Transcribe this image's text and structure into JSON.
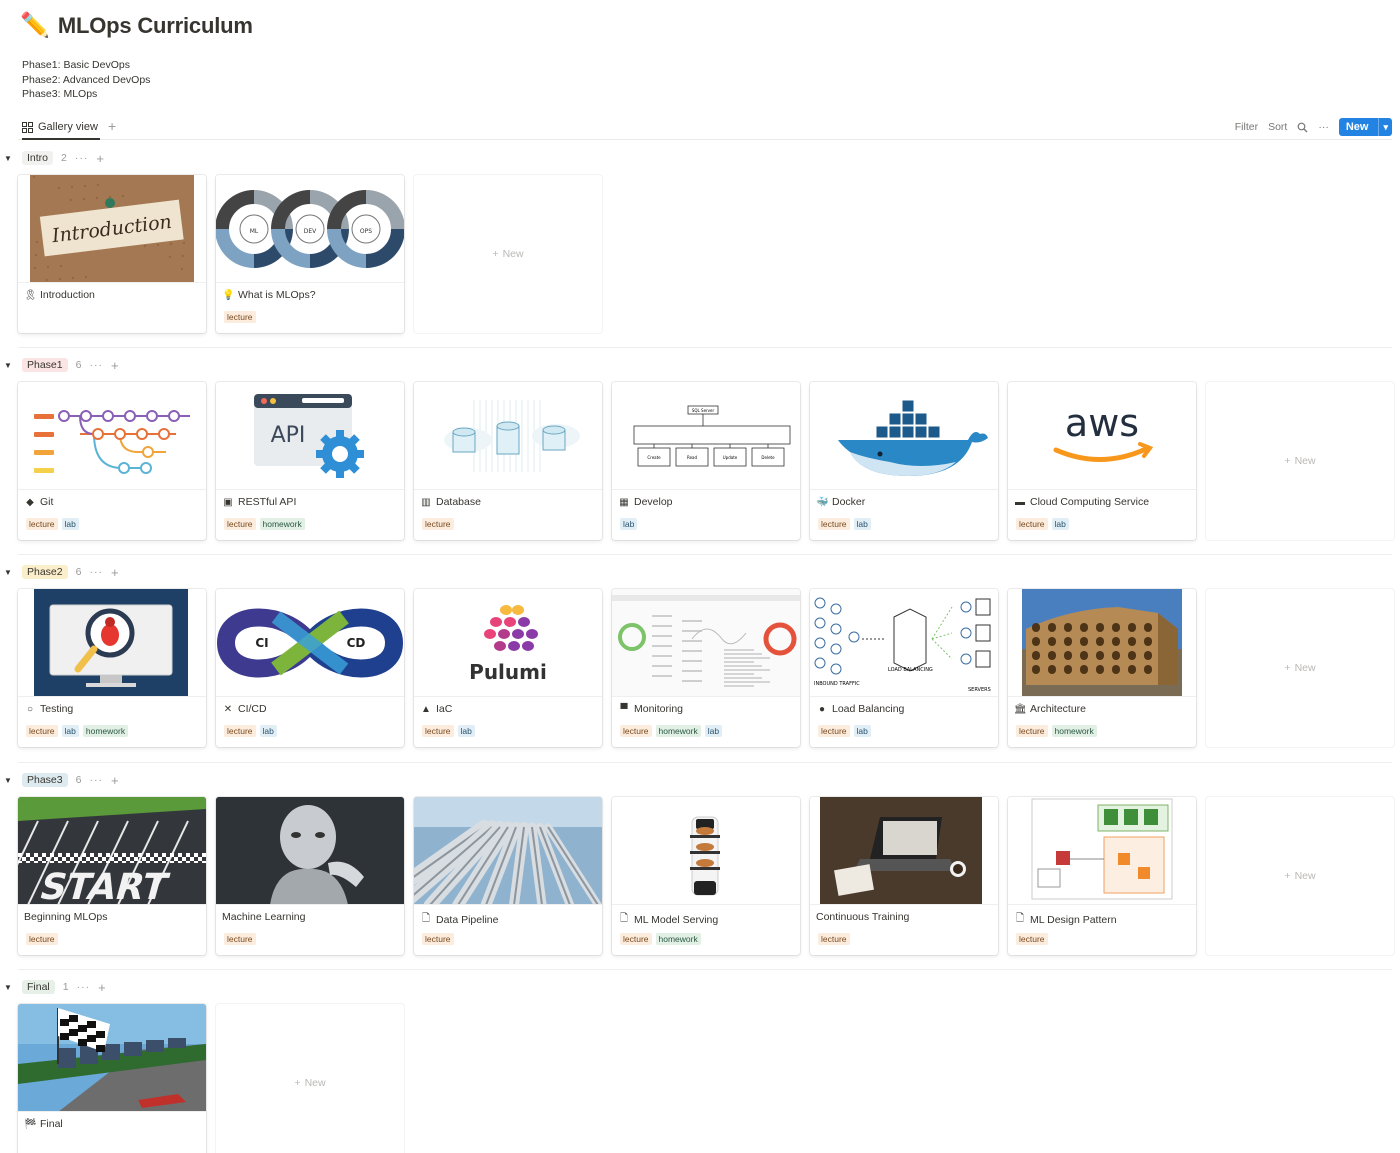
{
  "page": {
    "title": "MLOps Curriculum",
    "title_icon": "pencil-emoji",
    "description": [
      "Phase1: Basic DevOps",
      "Phase2: Advanced DevOps",
      "Phase3: MLOps"
    ]
  },
  "viewbar": {
    "view_label": "Gallery view",
    "add_view": "+",
    "filter": "Filter",
    "sort": "Sort",
    "more": "···",
    "new_label": "New",
    "new_caret": "⌄"
  },
  "tag_colors": {
    "lecture": "#fbecdd",
    "lab": "#e2eef6",
    "homework": "#e1efe5"
  },
  "accent": "#2383e2",
  "new_card_label": "New",
  "groups": [
    {
      "name": "Intro",
      "count": "2",
      "color": "#f1f1ef",
      "cards": [
        {
          "title": "Introduction",
          "icon": "ribbon-icon",
          "glyph": "🎗",
          "tags": []
        },
        {
          "title": "What is MLOps?",
          "icon": "lightbulb-icon",
          "glyph": "💡",
          "tags": [
            "lecture"
          ]
        }
      ]
    },
    {
      "name": "Phase1",
      "count": "6",
      "color": "#fbe4e4",
      "cards": [
        {
          "title": "Git",
          "icon": "git-icon",
          "glyph": "◆",
          "tags": [
            "lecture",
            "lab"
          ]
        },
        {
          "title": "RESTful API",
          "icon": "api-icon",
          "glyph": "▣",
          "tags": [
            "lecture",
            "homework"
          ]
        },
        {
          "title": "Database",
          "icon": "database-icon",
          "glyph": "▥",
          "tags": [
            "lecture"
          ]
        },
        {
          "title": "Develop",
          "icon": "develop-icon",
          "glyph": "▦",
          "tags": [
            "lab"
          ]
        },
        {
          "title": "Docker",
          "icon": "docker-icon",
          "glyph": "🐳",
          "tags": [
            "lecture",
            "lab"
          ]
        },
        {
          "title": "Cloud Computing Service",
          "icon": "aws-icon",
          "glyph": "▬",
          "tags": [
            "lecture",
            "lab"
          ]
        }
      ]
    },
    {
      "name": "Phase2",
      "count": "6",
      "color": "#fbeecb",
      "cards": [
        {
          "title": "Testing",
          "icon": "testing-icon",
          "glyph": "○",
          "tags": [
            "lecture",
            "lab",
            "homework"
          ]
        },
        {
          "title": "CI/CD",
          "icon": "cicd-icon",
          "glyph": "✕",
          "tags": [
            "lecture",
            "lab"
          ]
        },
        {
          "title": "IaC",
          "icon": "iac-icon",
          "glyph": "▲",
          "tags": [
            "lecture",
            "lab"
          ]
        },
        {
          "title": "Monitoring",
          "icon": "monitor-icon",
          "glyph": "▀",
          "tags": [
            "lecture",
            "homework",
            "lab"
          ]
        },
        {
          "title": "Load Balancing",
          "icon": "balance-icon",
          "glyph": "●",
          "tags": [
            "lecture",
            "lab"
          ]
        },
        {
          "title": "Architecture",
          "icon": "architecture-icon",
          "glyph": "🏛",
          "tags": [
            "lecture",
            "homework"
          ]
        }
      ]
    },
    {
      "name": "Phase3",
      "count": "6",
      "color": "#ddebf1",
      "cards": [
        {
          "title": "Beginning MLOps",
          "icon": "",
          "glyph": "",
          "tags": [
            "lecture"
          ]
        },
        {
          "title": "Machine Learning",
          "icon": "",
          "glyph": "",
          "tags": [
            "lecture"
          ]
        },
        {
          "title": "Data Pipeline",
          "icon": "page-icon",
          "glyph": "🗋",
          "tags": [
            "lecture"
          ]
        },
        {
          "title": "ML Model Serving",
          "icon": "page-icon",
          "glyph": "🗋",
          "tags": [
            "lecture",
            "homework"
          ]
        },
        {
          "title": "Continuous Training",
          "icon": "",
          "glyph": "",
          "tags": [
            "lecture"
          ]
        },
        {
          "title": "ML Design Pattern",
          "icon": "page-icon",
          "glyph": "🗋",
          "tags": [
            "lecture"
          ]
        }
      ]
    },
    {
      "name": "Final",
      "count": "1",
      "color": "#e6f0e8",
      "cards": [
        {
          "title": "Final",
          "icon": "checkered-flag-icon",
          "glyph": "🏁",
          "tags": []
        }
      ]
    }
  ]
}
